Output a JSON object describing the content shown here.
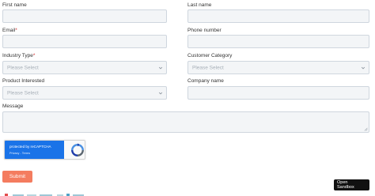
{
  "form": {
    "first_name": {
      "label": "First name",
      "value": ""
    },
    "last_name": {
      "label": "Last name",
      "value": ""
    },
    "email": {
      "label": "Email",
      "required_mark": "*",
      "value": ""
    },
    "phone": {
      "label": "Phone number",
      "value": ""
    },
    "industry_type": {
      "label": "Industry Type",
      "required_mark": "*",
      "selected": "Please Select"
    },
    "customer_category": {
      "label": "Customer Category",
      "selected": "Please Select"
    },
    "product_interested": {
      "label": "Product Interested",
      "selected": "Please Select"
    },
    "company_name": {
      "label": "Company name",
      "value": ""
    },
    "message": {
      "label": "Message",
      "value": ""
    },
    "submit_label": "Submit"
  },
  "recaptcha": {
    "text": "protected by reCAPTCHA",
    "privacy": "Privacy",
    "separator": " - ",
    "terms": "Terms",
    "logo_icon": "recaptcha-logo-icon"
  },
  "sandbox_badge": {
    "line1": "Open",
    "line2": "Sandbox"
  },
  "colors": {
    "field_bg": "#f3f5f7",
    "field_border": "#cfd6de",
    "required": "#d32f2f",
    "submit_bg": "#f47c5f",
    "recaptcha_blue": "#1a73e8",
    "badge_bg": "#111111"
  }
}
